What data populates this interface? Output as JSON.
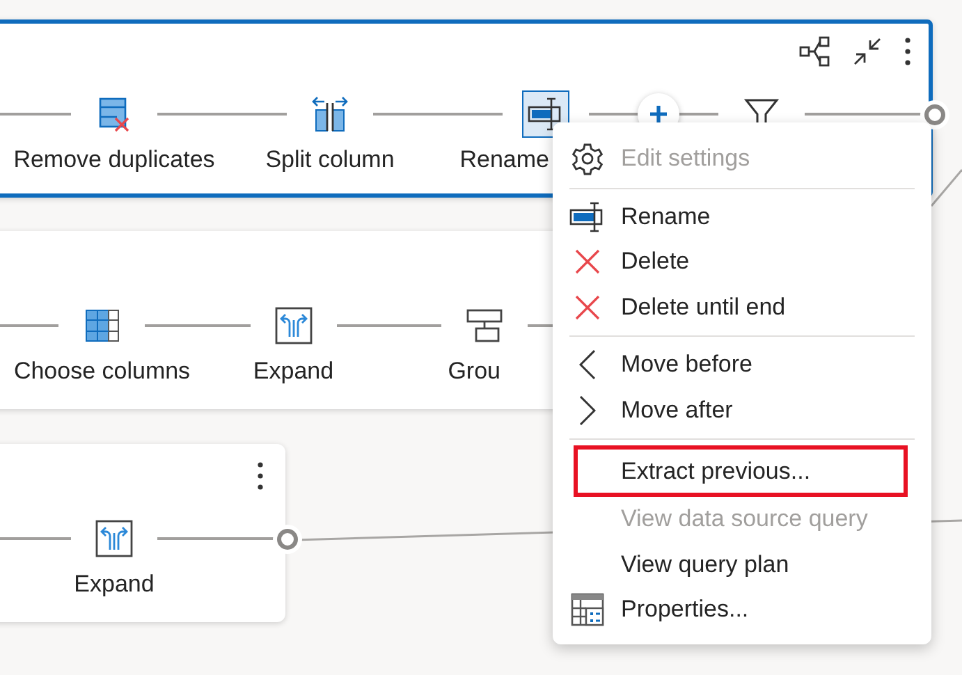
{
  "canvas": {
    "cards": [
      {
        "selected": true,
        "actions": [
          {
            "kind": "diagram"
          },
          {
            "kind": "collapse"
          },
          {
            "kind": "more"
          }
        ],
        "steps": [
          {
            "kind": "remove_duplicates",
            "label": "Remove duplicates",
            "selected": false,
            "cut_off": false
          },
          {
            "kind": "split_column",
            "label": "Split column",
            "selected": false,
            "cut_off": false
          },
          {
            "kind": "rename",
            "label": "Rename",
            "selected": true,
            "cut_off": true
          },
          {
            "kind": "add"
          },
          {
            "kind": "filter",
            "selected": false
          },
          {
            "kind": "output"
          }
        ]
      },
      {
        "selected": false,
        "steps": [
          {
            "kind": "choose_columns",
            "label": "Choose columns",
            "selected": false,
            "cut_off": false
          },
          {
            "kind": "expand",
            "label": "Expand",
            "selected": false,
            "cut_off": false
          },
          {
            "kind": "group",
            "label": "Grou",
            "selected": false,
            "cut_off": true
          }
        ]
      },
      {
        "selected": false,
        "actions": [
          {
            "kind": "more"
          }
        ],
        "steps": [
          {
            "kind": "expand",
            "label": "Expand",
            "selected": false,
            "cut_off": false
          },
          {
            "kind": "output"
          }
        ]
      }
    ]
  },
  "context_menu": {
    "items": [
      {
        "kind": "gear",
        "label": "Edit settings",
        "disabled": true,
        "highlighted": false,
        "separator_after": true
      },
      {
        "kind": "rename",
        "label": "Rename",
        "disabled": false,
        "highlighted": false,
        "separator_after": false
      },
      {
        "kind": "delete",
        "label": "Delete",
        "disabled": false,
        "highlighted": false,
        "separator_after": false
      },
      {
        "kind": "delete",
        "label": "Delete until end",
        "disabled": false,
        "highlighted": false,
        "separator_after": true
      },
      {
        "kind": "left",
        "label": "Move before",
        "disabled": false,
        "highlighted": false,
        "separator_after": false
      },
      {
        "kind": "right",
        "label": "Move after",
        "disabled": false,
        "highlighted": false,
        "separator_after": true
      },
      {
        "kind": "text",
        "label": "Extract previous...",
        "disabled": false,
        "highlighted": true,
        "separator_after": false
      },
      {
        "kind": "text",
        "label": "View data source query",
        "disabled": true,
        "highlighted": false,
        "separator_after": false
      },
      {
        "kind": "text",
        "label": "View query plan",
        "disabled": false,
        "highlighted": false,
        "separator_after": false
      },
      {
        "kind": "properties",
        "label": "Properties...",
        "disabled": false,
        "highlighted": false,
        "separator_after": false
      }
    ]
  }
}
